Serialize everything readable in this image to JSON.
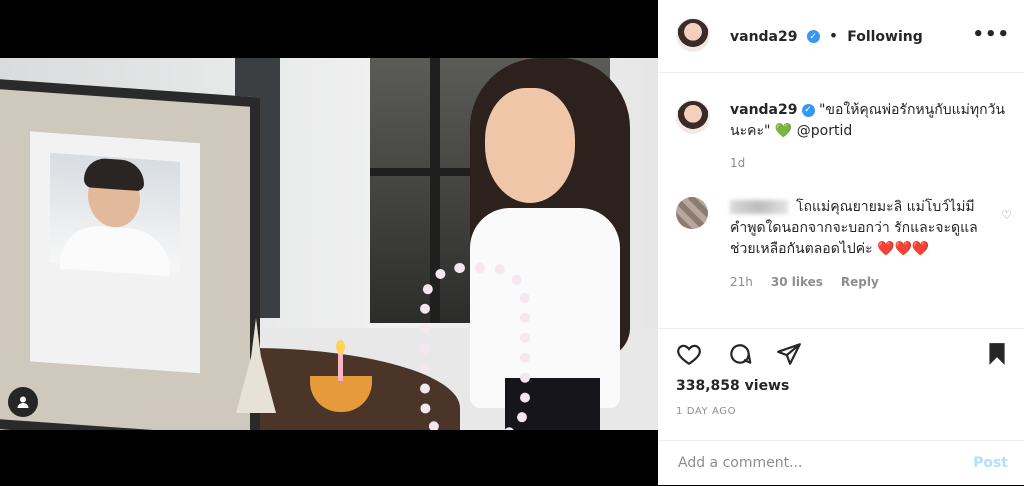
{
  "post": {
    "username": "vanda29",
    "follow_status": "Following",
    "more_label": "•••",
    "caption": "\"ขอให้คุณพ่อรักหนูกับแม่ทุกวันนะคะ\" 💚 @portid",
    "caption_time": "1d"
  },
  "comment": {
    "text": "โถแม่คุณยายมะลิ แม่โบว์ไม่มีคำพูดใดนอกจากจะบอกว่า รักและจะดูแลช่วยเหลือกันตลอดไปค่ะ ❤️❤️❤️",
    "time": "21h",
    "likes": "30 likes",
    "reply_label": "Reply"
  },
  "stats": {
    "views": "338,858 views",
    "date": "1 DAY AGO"
  },
  "composer": {
    "placeholder": "Add a comment...",
    "post_label": "Post"
  },
  "icons": {
    "verified": "verified-badge-icon",
    "like": "heart-icon",
    "comment": "comment-icon",
    "share": "share-icon",
    "save": "bookmark-icon",
    "user": "user-tag-icon"
  },
  "colors": {
    "verified": "#3897f0",
    "post_disabled": "#b2dffc",
    "muted": "#8e8e8e",
    "mention": "#00376b"
  }
}
